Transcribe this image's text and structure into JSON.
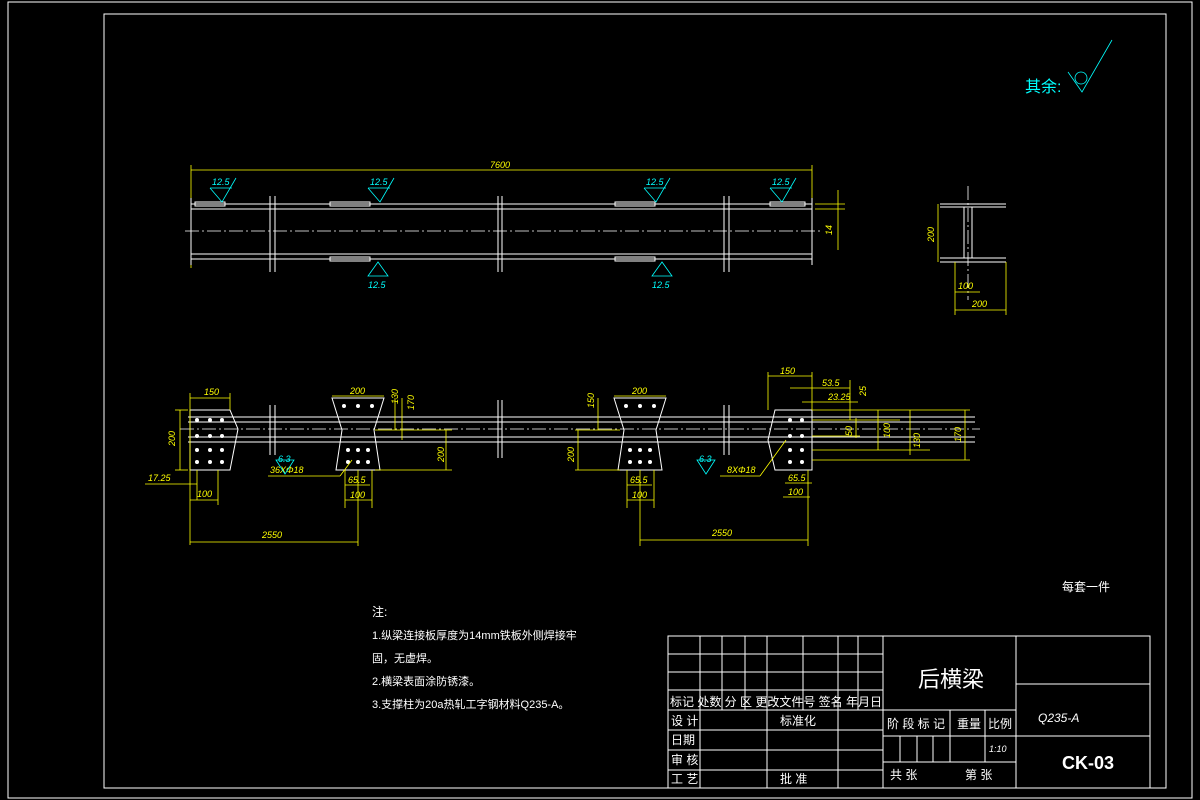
{
  "roughness_note": {
    "label": "其余:"
  },
  "top_view": {
    "overall_length": "7600",
    "thickness": "14",
    "roughness_top": [
      "12.5",
      "12.5",
      "12.5",
      "12.5"
    ],
    "roughness_bottom": [
      "12.5",
      "12.5"
    ]
  },
  "section_view": {
    "height": "200",
    "half_width": "100",
    "width": "200"
  },
  "front_view": {
    "left_plate_width": "150",
    "left_height": "200",
    "left_offset": "17.25",
    "left_bottom": "100",
    "left_spacing": "2550",
    "mid_plate_width_1": "200",
    "mid_dim_130": "130",
    "mid_dim_170": "170",
    "mid_dim_200_1": "200",
    "mid_dim_65_1": "65.5",
    "mid_dim_100_1": "100",
    "holes_1": "36XΦ18",
    "weld_1": "6.3",
    "mid_plate_width_2": "200",
    "mid_dim_150": "150",
    "mid_dim_200_2": "200",
    "mid_dim_65_2": "65.5",
    "mid_dim_100_2": "100",
    "right_plate_width": "150",
    "right_dim_53": "53.5",
    "right_dim_25": "25",
    "right_dim_23": "23.25",
    "right_dim_50": "50",
    "right_dim_100v": "100",
    "right_dim_130": "130",
    "right_dim_170": "170",
    "right_dim_65": "65.5",
    "right_dim_100": "100",
    "right_spacing": "2550",
    "holes_2": "8XΦ18",
    "weld_2": "6.3"
  },
  "per_set": "每套一件",
  "notes": {
    "title": "注:",
    "line1": "1.纵梁连接板厚度为14mm铁板外侧焊接牢",
    "line2": "固，无虚焊。",
    "line3": "2.横梁表面涂防锈漆。",
    "line4": "3.支撑柱为20a热轧工字钢材料Q235-A。"
  },
  "title_block": {
    "part_name": "后横梁",
    "material": "Q235-A",
    "drawing_no": "CK-03",
    "scale": "1:10",
    "row_headers": "标记 处数 分 区 更改文件号 签名 年月日",
    "design": "设 计",
    "standardize": "标准化",
    "stage_mark": "阶 段 标 记",
    "weight": "重量",
    "ratio": "比例",
    "date": "日期",
    "review": "审 核",
    "process": "工 艺",
    "approve": "批 准",
    "total_sheets": "共   张",
    "sheet_no": "第   张"
  }
}
